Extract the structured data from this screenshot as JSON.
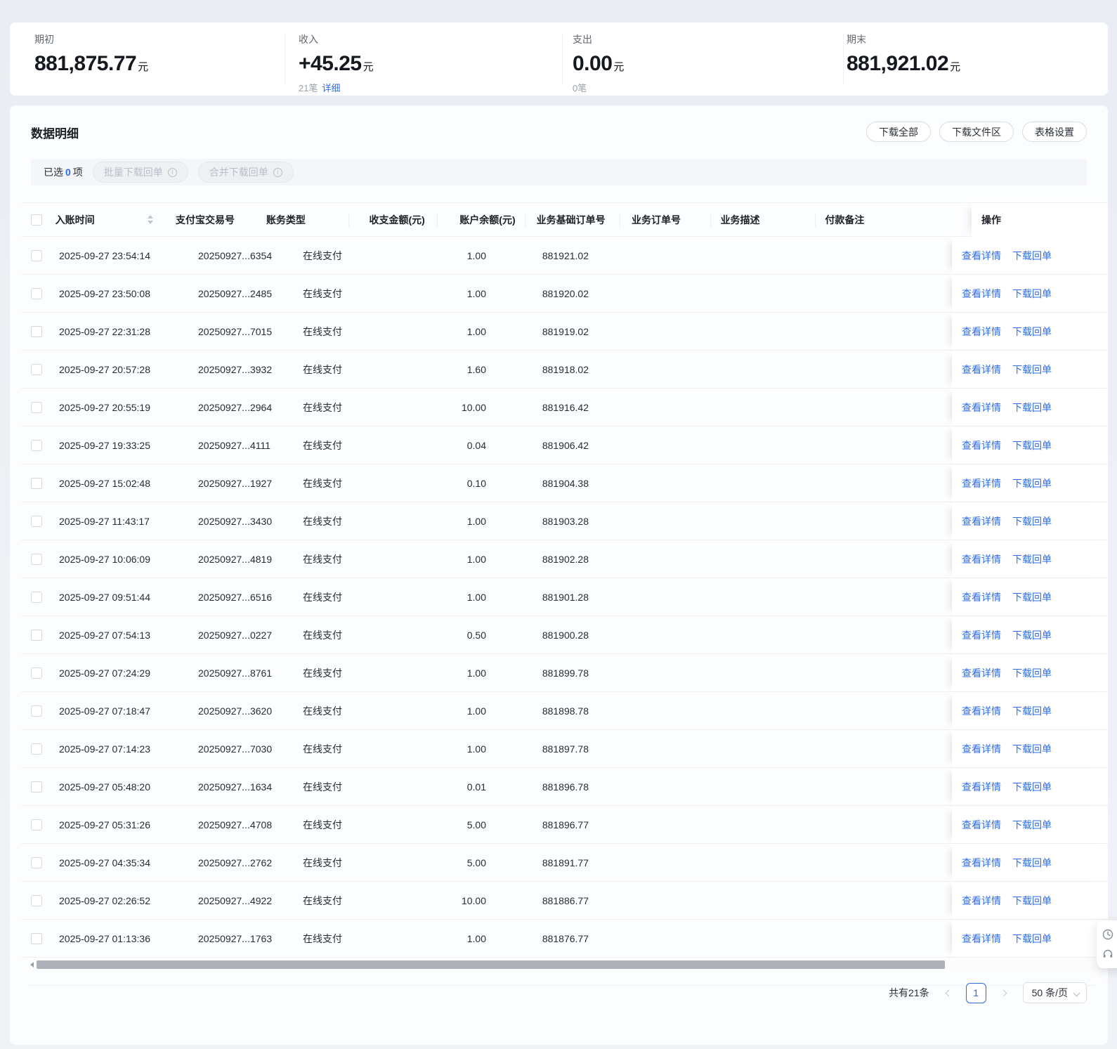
{
  "colors": {
    "accent_blue": "#2e6ce6",
    "page_background": "#eef1f6",
    "card_background": "#ffffff",
    "text_primary": "#20242b",
    "text_secondary": "#9ba1ab",
    "disabled_text": "#b9bfc9",
    "row_divider": "#efefef",
    "scrollbar_thumb": "#adb1b7"
  },
  "summary": {
    "items": [
      {
        "label": "期初",
        "value": "881,875.77",
        "unit": "元",
        "count": "",
        "link": ""
      },
      {
        "label": "收入",
        "value": "+45.25",
        "unit": "元",
        "count": "21笔",
        "link": "详细"
      },
      {
        "label": "支出",
        "value": "0.00",
        "unit": "元",
        "count": "0笔",
        "link": ""
      },
      {
        "label": "期末",
        "value": "881,921.02",
        "unit": "元",
        "count": "",
        "link": ""
      }
    ]
  },
  "detail": {
    "title": "数据明细",
    "toolbar": [
      "下载全部",
      "下载文件区",
      "表格设置"
    ],
    "selection": {
      "prefix": "已选",
      "count": "0",
      "suffix": "项",
      "batch_button": "批量下载回单",
      "merge_button": "合并下载回单"
    },
    "table": {
      "columns": [
        "入账时间",
        "支付宝交易号",
        "账务类型",
        "收支金额(元)",
        "账户余额(元)",
        "业务基础订单号",
        "业务订单号",
        "业务描述",
        "付款备注",
        "操作"
      ],
      "row_actions": [
        "查看详情",
        "下载回单"
      ],
      "rows": [
        {
          "time": "2025-09-27 23:54:14",
          "txn": "20250927...6354",
          "type": "在线支付",
          "amount": "1.00",
          "balance": "881921.02"
        },
        {
          "time": "2025-09-27 23:50:08",
          "txn": "20250927...2485",
          "type": "在线支付",
          "amount": "1.00",
          "balance": "881920.02"
        },
        {
          "time": "2025-09-27 22:31:28",
          "txn": "20250927...7015",
          "type": "在线支付",
          "amount": "1.00",
          "balance": "881919.02"
        },
        {
          "time": "2025-09-27 20:57:28",
          "txn": "20250927...3932",
          "type": "在线支付",
          "amount": "1.60",
          "balance": "881918.02"
        },
        {
          "time": "2025-09-27 20:55:19",
          "txn": "20250927...2964",
          "type": "在线支付",
          "amount": "10.00",
          "balance": "881916.42"
        },
        {
          "time": "2025-09-27 19:33:25",
          "txn": "20250927...4111",
          "type": "在线支付",
          "amount": "0.04",
          "balance": "881906.42"
        },
        {
          "time": "2025-09-27 15:02:48",
          "txn": "20250927...1927",
          "type": "在线支付",
          "amount": "0.10",
          "balance": "881904.38"
        },
        {
          "time": "2025-09-27 11:43:17",
          "txn": "20250927...3430",
          "type": "在线支付",
          "amount": "1.00",
          "balance": "881903.28"
        },
        {
          "time": "2025-09-27 10:06:09",
          "txn": "20250927...4819",
          "type": "在线支付",
          "amount": "1.00",
          "balance": "881902.28"
        },
        {
          "time": "2025-09-27 09:51:44",
          "txn": "20250927...6516",
          "type": "在线支付",
          "amount": "1.00",
          "balance": "881901.28"
        },
        {
          "time": "2025-09-27 07:54:13",
          "txn": "20250927...0227",
          "type": "在线支付",
          "amount": "0.50",
          "balance": "881900.28"
        },
        {
          "time": "2025-09-27 07:24:29",
          "txn": "20250927...8761",
          "type": "在线支付",
          "amount": "1.00",
          "balance": "881899.78"
        },
        {
          "time": "2025-09-27 07:18:47",
          "txn": "20250927...3620",
          "type": "在线支付",
          "amount": "1.00",
          "balance": "881898.78"
        },
        {
          "time": "2025-09-27 07:14:23",
          "txn": "20250927...7030",
          "type": "在线支付",
          "amount": "1.00",
          "balance": "881897.78"
        },
        {
          "time": "2025-09-27 05:48:20",
          "txn": "20250927...1634",
          "type": "在线支付",
          "amount": "0.01",
          "balance": "881896.78"
        },
        {
          "time": "2025-09-27 05:31:26",
          "txn": "20250927...4708",
          "type": "在线支付",
          "amount": "5.00",
          "balance": "881896.77"
        },
        {
          "time": "2025-09-27 04:35:34",
          "txn": "20250927...2762",
          "type": "在线支付",
          "amount": "5.00",
          "balance": "881891.77"
        },
        {
          "time": "2025-09-27 02:26:52",
          "txn": "20250927...4922",
          "type": "在线支付",
          "amount": "10.00",
          "balance": "881886.77"
        },
        {
          "time": "2025-09-27 01:13:36",
          "txn": "20250927...1763",
          "type": "在线支付",
          "amount": "1.00",
          "balance": "881876.77"
        }
      ]
    },
    "pagination": {
      "total": "共有21条",
      "current_page": "1",
      "page_size": "50 条/页"
    }
  },
  "floating_panel": {
    "icons": [
      "clock-icon",
      "headset-icon"
    ]
  }
}
